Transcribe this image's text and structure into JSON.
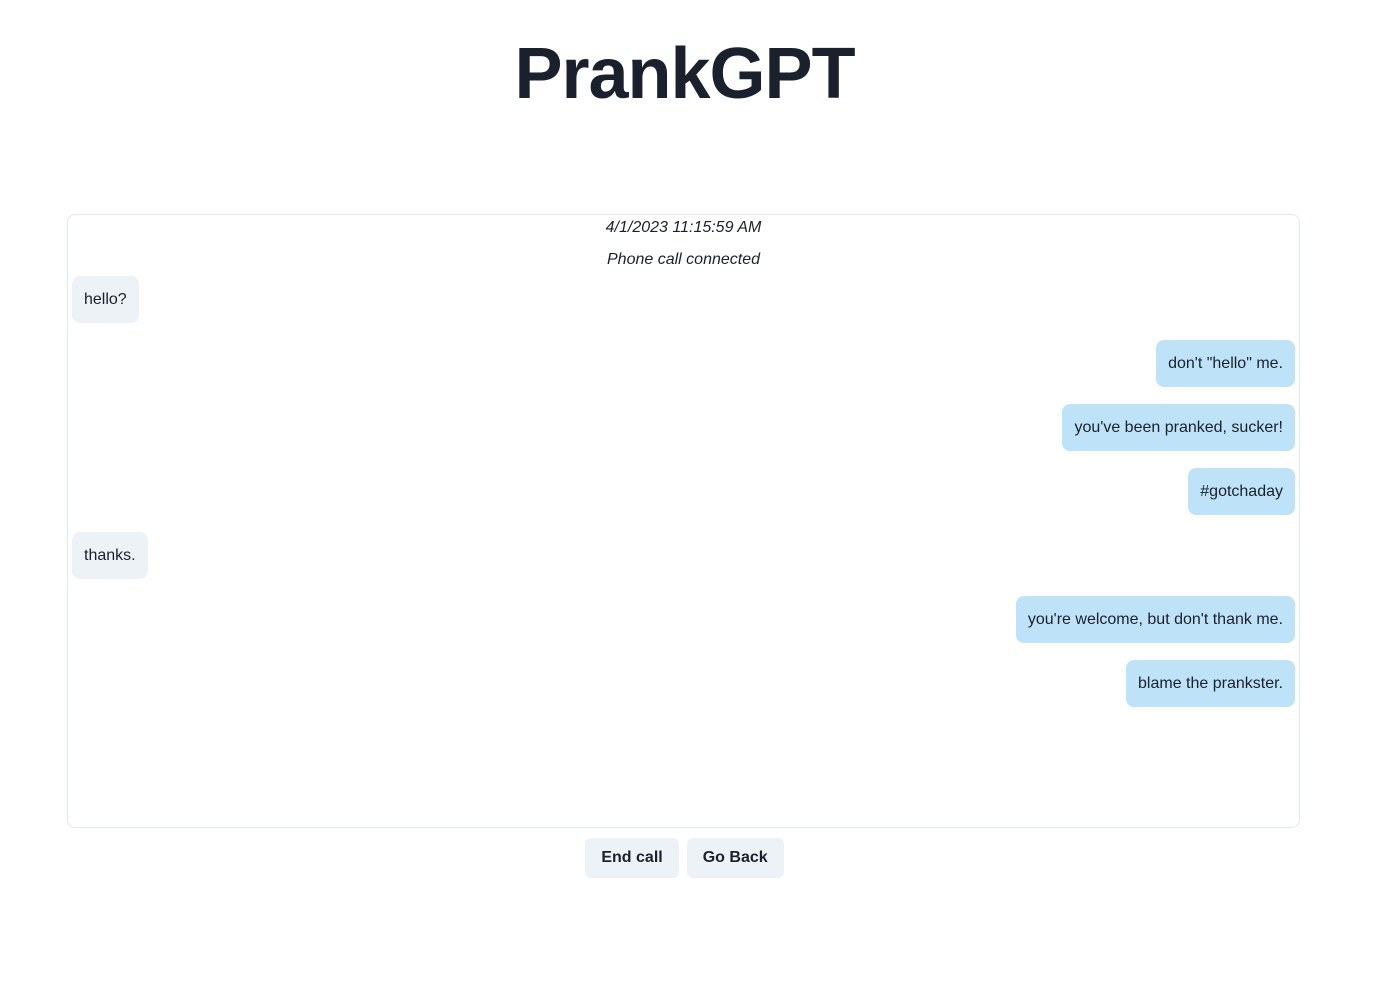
{
  "app": {
    "title": "PrankGPT"
  },
  "chat": {
    "timestamp": "4/1/2023 11:15:59 AM",
    "status": "Phone call connected",
    "messages": [
      {
        "sender": "callee",
        "text": "hello?"
      },
      {
        "sender": "prankster",
        "text": "don't \"hello\" me."
      },
      {
        "sender": "prankster",
        "text": "you've been pranked, sucker!"
      },
      {
        "sender": "prankster",
        "text": "#gotchaday"
      },
      {
        "sender": "callee",
        "text": "thanks."
      },
      {
        "sender": "prankster",
        "text": "you're welcome, but don't thank me."
      },
      {
        "sender": "prankster",
        "text": "blame the prankster."
      }
    ]
  },
  "actions": {
    "end_call_label": "End call",
    "go_back_label": "Go Back"
  },
  "colors": {
    "callee_bubble": "#edf2f7",
    "prankster_bubble": "#bee3f8",
    "button_bg": "#edf2f7",
    "text": "#1a202c",
    "border": "#e2e8f0"
  }
}
